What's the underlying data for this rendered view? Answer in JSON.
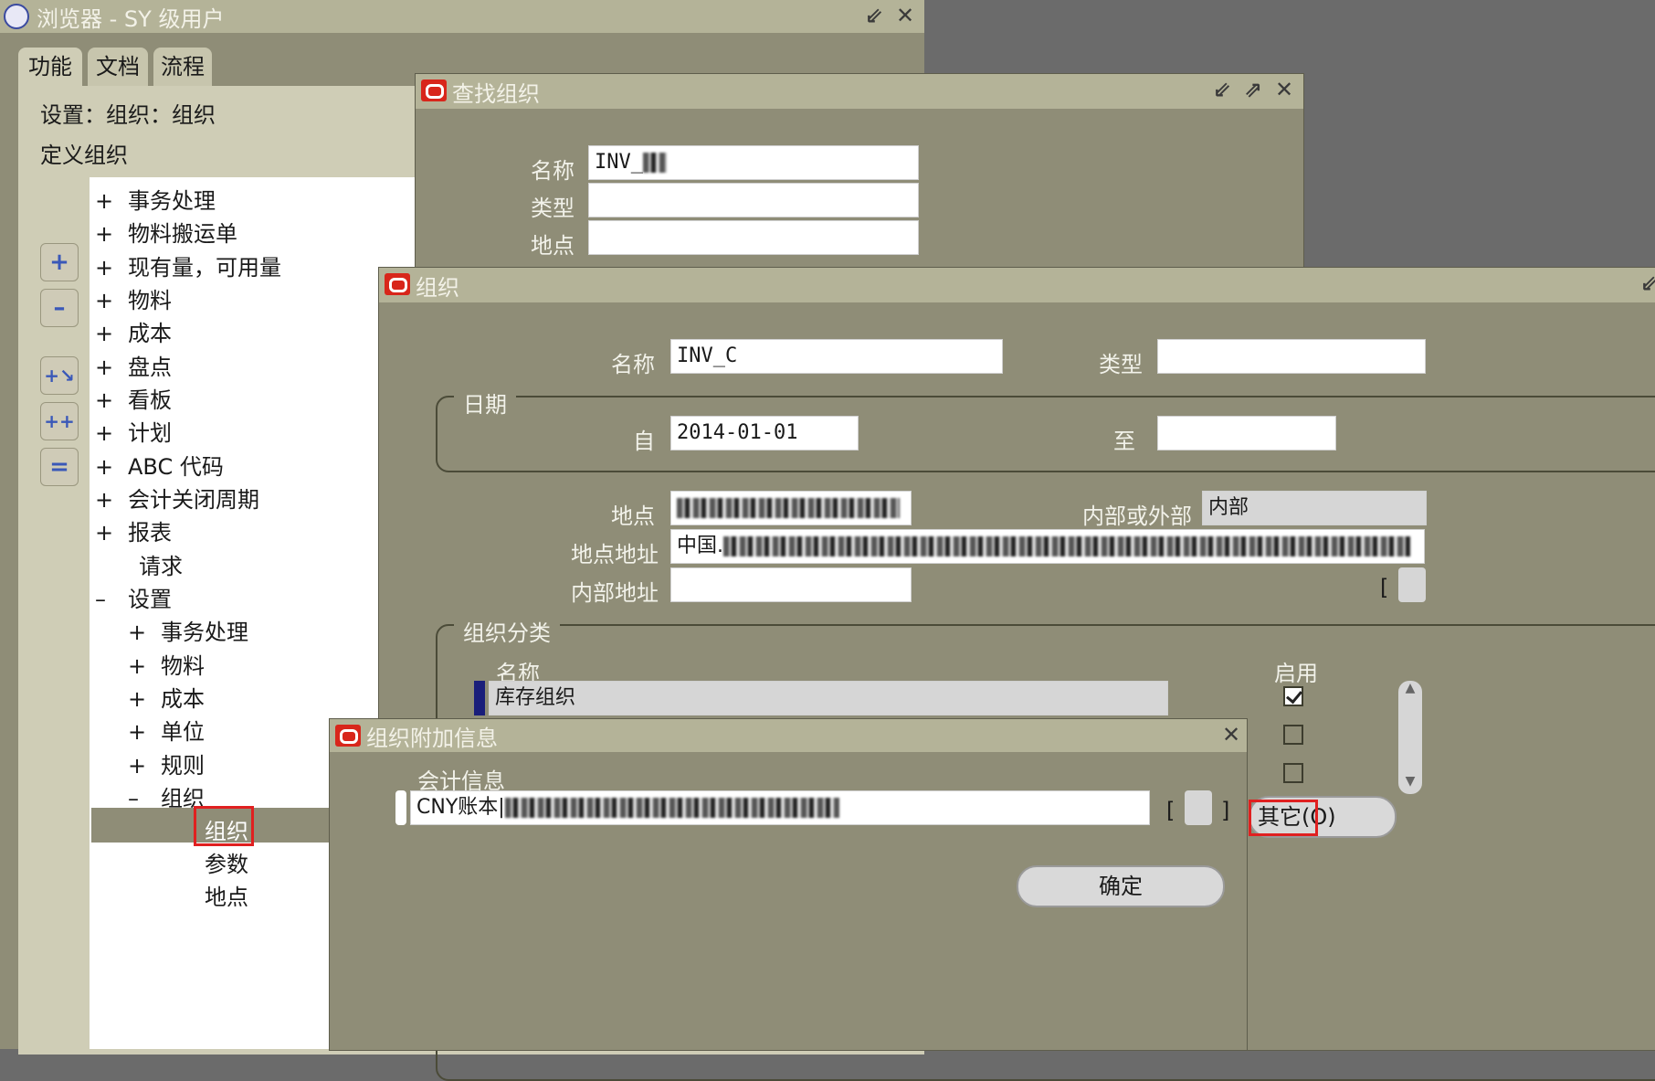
{
  "navigator": {
    "title": "浏览器 - SY   级用户",
    "tabs": [
      "功能",
      "文档",
      "流程"
    ],
    "breadcrumb": "设置：组织：组织",
    "subtitle": "定义组织",
    "tree": [
      {
        "sign": "+",
        "label": "事务处理"
      },
      {
        "sign": "+",
        "label": "物料搬运单"
      },
      {
        "sign": "+",
        "label": "现有量，可用量"
      },
      {
        "sign": "+",
        "label": "物料"
      },
      {
        "sign": "+",
        "label": "成本"
      },
      {
        "sign": "+",
        "label": "盘点"
      },
      {
        "sign": "+",
        "label": "看板"
      },
      {
        "sign": "+",
        "label": "计划"
      },
      {
        "sign": "+",
        "label": "ABC 代码"
      },
      {
        "sign": "+",
        "label": "会计关闭周期"
      },
      {
        "sign": "+",
        "label": "报表"
      },
      {
        "sign": "",
        "label": "请求"
      },
      {
        "sign": "–",
        "label": "设置"
      },
      {
        "sign": "+",
        "label": "事务处理"
      },
      {
        "sign": "+",
        "label": "物料"
      },
      {
        "sign": "+",
        "label": "成本"
      },
      {
        "sign": "+",
        "label": "单位"
      },
      {
        "sign": "+",
        "label": "规则"
      },
      {
        "sign": "–",
        "label": "组织"
      },
      {
        "sign": "",
        "label": "组织"
      },
      {
        "sign": "",
        "label": "参数"
      },
      {
        "sign": "",
        "label": "地点"
      }
    ],
    "side_buttons": [
      "+",
      "–",
      "+↘",
      "++",
      "=="
    ]
  },
  "find_org": {
    "title": "查找组织",
    "name_label": "名称",
    "name_value": "INV_",
    "type_label": "类型",
    "location_label": "地点"
  },
  "org": {
    "title": "组织",
    "name_label": "名称",
    "name_value": "INV_C",
    "type_label": "类型",
    "dates_group": "日期",
    "from_label": "自",
    "from_value": "2014-01-01",
    "to_label": "至",
    "location_label": "地点",
    "location_value": "",
    "internal_external_label": "内部或外部",
    "internal_external_value": "内部",
    "location_address_label": "地点地址",
    "location_address_value": "中国.",
    "internal_address_label": "内部地址",
    "classification_group": "组织分类",
    "col_name": "名称",
    "col_enabled": "启用",
    "classification_row": "库存组织",
    "others_button": "其它(O)"
  },
  "additional": {
    "title": "组织附加信息",
    "section": "会计信息",
    "value": "CNY账本|",
    "ok_button": "确定"
  }
}
